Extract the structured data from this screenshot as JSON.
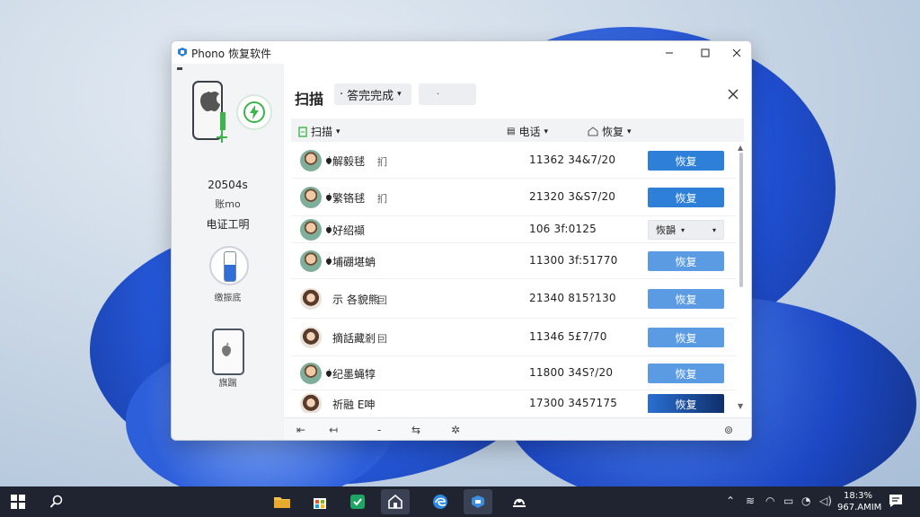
{
  "window": {
    "title": "Phono 恢复软件"
  },
  "sidebar": {
    "device_model": "20504s",
    "device_sub": "账mo",
    "device_status": "电证工明",
    "battery_label": "缴振底",
    "battery_level": 0.55,
    "phone2_label": "旗踹"
  },
  "main": {
    "title": "扫描",
    "filter_status": "答完完成",
    "filter2_value": "·",
    "columns": {
      "scan": "扫描",
      "phone": "电话",
      "recover": "恢复"
    },
    "rows": [
      {
        "avatar": "male",
        "apple": true,
        "name": "解毅毬",
        "tag": "扪",
        "number": "11362 34&7/20",
        "button": "恢复",
        "style": "primary"
      },
      {
        "avatar": "male",
        "apple": true,
        "name": "繁铬毬",
        "tag": "扪",
        "number": "21320 3&S7/20",
        "button": "恢复",
        "style": "primary"
      },
      {
        "avatar": "male",
        "apple": true,
        "name": "好绍襭",
        "tag": "",
        "number": "106 3f:0125",
        "button": "恢韻",
        "style": "dropdown"
      },
      {
        "avatar": "male",
        "apple": true,
        "name": "埔硼堪蚺",
        "tag": "",
        "number": "11300 3f:51770",
        "button": "恢复",
        "style": "soft"
      },
      {
        "avatar": "female",
        "apple": false,
        "name": "示 各貌熊",
        "tag": "囙",
        "number": "21340 815?130",
        "button": "恢复",
        "style": "soft"
      },
      {
        "avatar": "female",
        "apple": false,
        "name": "摘話藏剎",
        "tag": "囙",
        "number": "11346 5£7/70",
        "button": "恢复",
        "style": "soft"
      },
      {
        "avatar": "male",
        "apple": true,
        "name": "纪墨蝇犉",
        "tag": "",
        "number": "11800 34S?/20",
        "button": "恢复",
        "style": "soft"
      },
      {
        "avatar": "female",
        "apple": false,
        "name": "祈融 E呻",
        "tag": "",
        "number": "17300 3457175",
        "button": "恢复",
        "style": "dark"
      }
    ]
  },
  "taskbar": {
    "clock_time": "18:3%",
    "clock_date": "967.AMIM"
  },
  "colors": {
    "accent": "#2e7fd8",
    "charge_green": "#3cb54a"
  }
}
